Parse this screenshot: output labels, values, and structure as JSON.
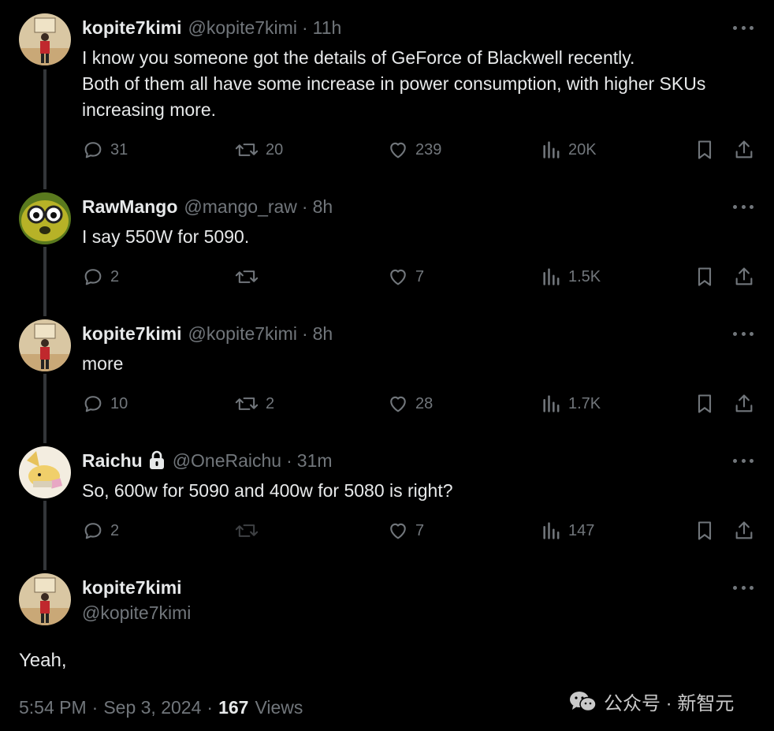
{
  "tweets": [
    {
      "name": "kopite7kimi",
      "handle": "@kopite7kimi",
      "time": "11h",
      "lines": [
        "I know you someone got the details of GeForce of Blackwell recently.",
        "Both of them all have some increase in power consumption, with higher SKUs",
        "increasing more."
      ],
      "replies": "31",
      "reposts": "20",
      "likes": "239",
      "views": "20K"
    },
    {
      "name": "RawMango",
      "handle": "@mango_raw",
      "time": "8h",
      "lines": [
        "I say 550W for 5090."
      ],
      "replies": "2",
      "reposts": "",
      "likes": "7",
      "views": "1.5K"
    },
    {
      "name": "kopite7kimi",
      "handle": "@kopite7kimi",
      "time": "8h",
      "lines": [
        "more"
      ],
      "replies": "10",
      "reposts": "2",
      "likes": "28",
      "views": "1.7K"
    },
    {
      "name": "Raichu",
      "handle": "@OneRaichu",
      "time": "31m",
      "lines": [
        "So, 600w for 5090 and 400w for 5080 is right?"
      ],
      "replies": "2",
      "reposts": "",
      "likes": "7",
      "views": "147"
    }
  ],
  "main": {
    "name": "kopite7kimi",
    "handle": "@kopite7kimi",
    "text": "Yeah,",
    "time": "5:54 PM",
    "date": "Sep 3, 2024",
    "views_count": "167",
    "views_label": "Views"
  },
  "separator": "·",
  "watermark": "公众号 · 新智元",
  "colors": {
    "background": "#000000",
    "primary_text": "#e7e9ea",
    "secondary_text": "#71767b",
    "thread_line": "#333639"
  },
  "icons": [
    "reply-icon",
    "repost-icon",
    "like-icon",
    "views-icon",
    "bookmark-icon",
    "share-icon",
    "more-icon",
    "lock-icon",
    "wechat-icon"
  ]
}
